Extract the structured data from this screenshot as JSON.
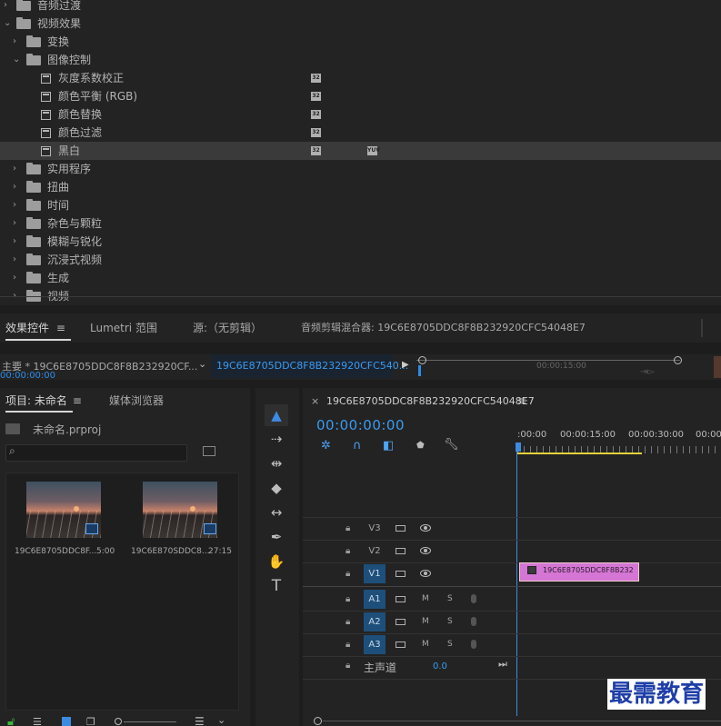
{
  "effects_tree": {
    "rows": [
      {
        "label": "音频过渡",
        "kind": "folder",
        "level": 0,
        "expanded": false
      },
      {
        "label": "视频效果",
        "kind": "folder",
        "level": 0,
        "expanded": true
      },
      {
        "label": "变换",
        "kind": "folder",
        "level": 1,
        "expanded": false
      },
      {
        "label": "图像控制",
        "kind": "folder",
        "level": 1,
        "expanded": true
      },
      {
        "label": "灰度系数校正",
        "kind": "effect",
        "level": 2,
        "badge1": "32",
        "badge2": ""
      },
      {
        "label": "颜色平衡 (RGB)",
        "kind": "effect",
        "level": 2,
        "badge1": "32",
        "badge2": ""
      },
      {
        "label": "颜色替换",
        "kind": "effect",
        "level": 2,
        "badge1": "32",
        "badge2": ""
      },
      {
        "label": "颜色过滤",
        "kind": "effect",
        "level": 2,
        "badge1": "32",
        "badge2": ""
      },
      {
        "label": "黑白",
        "kind": "effect",
        "level": 2,
        "badge1": "32",
        "badge2": "YUV",
        "selected": true
      },
      {
        "label": "实用程序",
        "kind": "folder",
        "level": 1,
        "expanded": false
      },
      {
        "label": "扭曲",
        "kind": "folder",
        "level": 1,
        "expanded": false
      },
      {
        "label": "时间",
        "kind": "folder",
        "level": 1,
        "expanded": false
      },
      {
        "label": "杂色与颗粒",
        "kind": "folder",
        "level": 1,
        "expanded": false
      },
      {
        "label": "模糊与锐化",
        "kind": "folder",
        "level": 1,
        "expanded": false
      },
      {
        "label": "沉浸式视频",
        "kind": "folder",
        "level": 1,
        "expanded": false
      },
      {
        "label": "生成",
        "kind": "folder",
        "level": 1,
        "expanded": false
      },
      {
        "label": "视频",
        "kind": "folder",
        "level": 1,
        "expanded": false
      }
    ]
  },
  "panel_tabs": {
    "effect_controls": "效果控件",
    "lumetri": "Lumetri 范围",
    "source": "源:（无剪辑）",
    "audio_mixer": "音频剪辑混合器: 19C6E8705DDC8F8B232920CFC54048E7"
  },
  "effect_controls": {
    "master": "主要 * 19C6E8705DDC8F8B232920CF...",
    "sequence": "19C6E8705DDC8F8B232920CFC540...",
    "time_mark": "00:00:15:00",
    "timecode": "00:00:00:00"
  },
  "project": {
    "tab": "项目: 未命名",
    "media_browser": "媒体浏览器",
    "file": "未命名.prproj",
    "items": [
      {
        "name": "19C6E8705DDC8F...",
        "duration": "5:00"
      },
      {
        "name": "19C6E870SDDC8...",
        "duration": "27:15"
      }
    ]
  },
  "timeline": {
    "sequence_tab": "19C6E8705DDC8F8B232920CFC54048E7",
    "timecode": "00:00:00:00",
    "ruler": [
      ":00:00",
      "00:00:15:00",
      "00:00:30:00",
      "00:00"
    ],
    "video_tracks": [
      "V3",
      "V2",
      "V1"
    ],
    "audio_tracks": [
      "A1",
      "A2",
      "A3"
    ],
    "master_label": "主声道",
    "master_value": "0.0",
    "clip_label": "19C6E8705DDC8F8B232",
    "m": "M",
    "s": "S"
  },
  "watermark": "最需教育",
  "colors": {
    "accent": "#2d8ceb",
    "clip": "#d576d5",
    "selected_track": "#1e4f7a"
  }
}
